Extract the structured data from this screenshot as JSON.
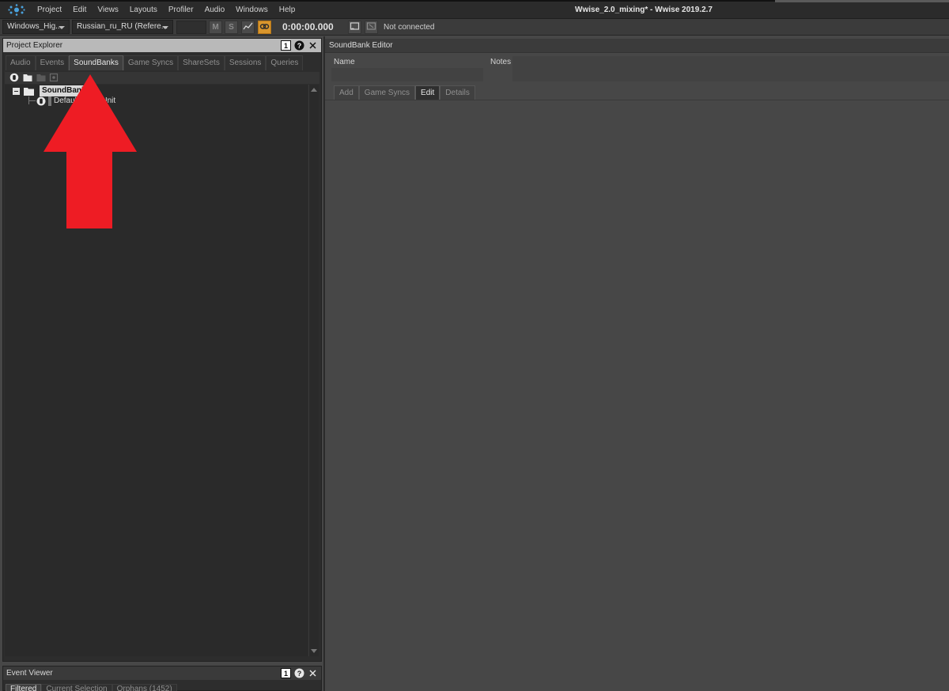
{
  "app": {
    "window_title": "Wwise_2.0_mixing* - Wwise 2019.2.7",
    "menu": [
      "Project",
      "Edit",
      "Views",
      "Layouts",
      "Profiler",
      "Audio",
      "Windows",
      "Help"
    ]
  },
  "toolbar": {
    "platform": "Windows_Hig...",
    "language": "Russian_ru_RU (Refere...",
    "mute_label": "M",
    "solo_label": "S",
    "time": "0:00:00.000",
    "connection_status": "Not connected"
  },
  "project_explorer": {
    "title": "Project Explorer",
    "header_buttons": [
      "1",
      "?",
      "×"
    ],
    "tabs": [
      "Audio",
      "Events",
      "SoundBanks",
      "Game Syncs",
      "ShareSets",
      "Sessions",
      "Queries"
    ],
    "active_tab": "SoundBanks",
    "tree": {
      "root_label": "SoundBanks",
      "child_label": "Default Work Unit"
    }
  },
  "event_viewer": {
    "title": "Event Viewer",
    "header_buttons": [
      "1",
      "?",
      "×"
    ],
    "tabs": [
      "Filtered",
      "Current Selection",
      "Orphans (1452)"
    ]
  },
  "soundbank_editor": {
    "title": "SoundBank Editor",
    "name_label": "Name",
    "notes_label": "Notes",
    "tabs": [
      "Add",
      "Game Syncs",
      "Edit",
      "Details"
    ],
    "active_tab": "Edit"
  },
  "colors": {
    "accent_orange": "#d9962d",
    "annotation_arrow": "#ee1c24"
  }
}
